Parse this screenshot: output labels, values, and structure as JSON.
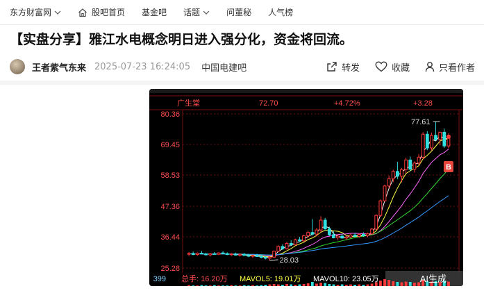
{
  "nav": {
    "site": "东方财富网",
    "home": "股吧首页",
    "fund": "基金吧",
    "topic": "话题",
    "dong": "问董秘",
    "popular": "人气榜"
  },
  "post": {
    "title": "【实盘分享】雅江水电概念明日进入强分化，资金将回流。",
    "author": "王者紫气东来",
    "time": "2025-07-23 16:24:05",
    "bar": "中国电建吧",
    "forward": "转发",
    "collect": "收藏",
    "only_author": "只看作者"
  },
  "chart_data": {
    "type": "candlestick",
    "stock_label": "广生堂",
    "header_price": "72.70",
    "header_change": "+4.72%",
    "header_amount": "+3.28",
    "y_ticks": [
      "80.36",
      "69.45",
      "58.53",
      "47.36",
      "36.44",
      "25.28"
    ],
    "ylim": [
      25.28,
      80.36
    ],
    "high_label": "77.61",
    "low_label": "28.03",
    "badge": "B",
    "volume_axis": "399",
    "vol_text": "总手: 16.20万",
    "mavol5_text": "MAVOL5: 19.01万",
    "mavol10_text": "MAVOL10: 23.05万",
    "ai_label": "AI生成",
    "colors": {
      "up": "#ff3b3b",
      "down": "#33e0e0",
      "ma5": "#ffffff",
      "ma10": "#ffff44",
      "ma20": "#ff66ff",
      "ma30": "#33dd33",
      "ma60": "#3399ff"
    },
    "candles": [
      [
        30.2,
        31.0,
        29.6,
        30.5
      ],
      [
        30.5,
        31.2,
        29.9,
        30.1
      ],
      [
        30.1,
        30.9,
        29.7,
        30.6
      ],
      [
        30.6,
        31.4,
        30.2,
        30.3
      ],
      [
        30.3,
        30.8,
        29.8,
        30.0
      ],
      [
        30.0,
        30.7,
        29.5,
        30.4
      ],
      [
        30.4,
        31.0,
        30.0,
        30.2
      ],
      [
        30.2,
        30.9,
        29.9,
        30.7
      ],
      [
        30.7,
        31.3,
        30.3,
        30.4
      ],
      [
        30.4,
        30.9,
        29.9,
        30.1
      ],
      [
        30.1,
        30.6,
        29.6,
        30.3
      ],
      [
        30.3,
        30.8,
        29.8,
        29.9
      ],
      [
        29.9,
        30.5,
        29.4,
        30.2
      ],
      [
        30.2,
        30.7,
        29.7,
        29.8
      ],
      [
        29.8,
        30.3,
        29.2,
        29.5
      ],
      [
        29.5,
        30.1,
        28.9,
        29.8
      ],
      [
        29.8,
        30.4,
        29.3,
        29.4
      ],
      [
        29.4,
        30.0,
        28.8,
        29.1
      ],
      [
        29.1,
        29.6,
        28.4,
        28.8
      ],
      [
        28.8,
        29.5,
        28.0,
        29.2
      ],
      [
        29.2,
        31.6,
        29.0,
        31.3
      ],
      [
        31.3,
        33.4,
        31.0,
        33.0
      ],
      [
        33.0,
        33.8,
        31.8,
        32.2
      ],
      [
        32.2,
        34.6,
        31.9,
        34.1
      ],
      [
        34.1,
        35.2,
        33.2,
        33.6
      ],
      [
        33.6,
        35.8,
        33.3,
        35.4
      ],
      [
        35.4,
        36.4,
        34.6,
        35.0
      ],
      [
        35.0,
        37.2,
        34.7,
        36.8
      ],
      [
        36.8,
        38.6,
        36.2,
        38.0
      ],
      [
        38.0,
        42.8,
        36.9,
        37.4
      ],
      [
        37.4,
        39.6,
        36.6,
        38.9
      ],
      [
        38.9,
        43.8,
        38.1,
        42.4
      ],
      [
        42.4,
        43.2,
        38.7,
        39.3
      ],
      [
        39.3,
        40.1,
        36.8,
        37.2
      ],
      [
        37.2,
        38.4,
        35.9,
        36.1
      ],
      [
        36.1,
        37.3,
        35.3,
        36.7
      ],
      [
        36.7,
        37.5,
        35.8,
        36.0
      ],
      [
        36.0,
        36.9,
        35.4,
        36.4
      ],
      [
        36.4,
        37.6,
        35.9,
        37.1
      ],
      [
        37.1,
        37.9,
        36.3,
        36.6
      ],
      [
        36.6,
        37.7,
        36.1,
        37.3
      ],
      [
        37.3,
        38.1,
        36.5,
        36.8
      ],
      [
        36.8,
        37.9,
        36.3,
        37.5
      ],
      [
        37.5,
        39.6,
        37.2,
        39.2
      ],
      [
        39.2,
        44.5,
        38.9,
        44.1
      ],
      [
        44.1,
        49.8,
        43.6,
        49.3
      ],
      [
        49.3,
        55.1,
        48.9,
        54.6
      ],
      [
        54.6,
        58.3,
        53.8,
        57.2
      ],
      [
        57.2,
        60.4,
        56.0,
        59.8
      ],
      [
        59.8,
        63.2,
        57.1,
        58.1
      ],
      [
        58.1,
        61.0,
        55.9,
        60.5
      ],
      [
        60.5,
        64.7,
        59.2,
        63.9
      ],
      [
        63.9,
        65.1,
        59.9,
        60.6
      ],
      [
        60.6,
        63.4,
        59.4,
        62.8
      ],
      [
        62.8,
        66.0,
        61.9,
        64.9
      ],
      [
        64.9,
        73.8,
        64.1,
        73.1
      ],
      [
        73.1,
        74.2,
        67.4,
        68.2
      ],
      [
        68.2,
        73.6,
        67.3,
        72.7
      ],
      [
        72.7,
        77.61,
        70.8,
        71.2
      ],
      [
        71.2,
        74.0,
        69.2,
        73.8
      ],
      [
        73.8,
        75.1,
        68.2,
        68.9
      ],
      [
        68.9,
        73.4,
        68.1,
        72.7
      ]
    ],
    "volumes": [
      3,
      2,
      2,
      3,
      2,
      2,
      3,
      2,
      2,
      2,
      3,
      2,
      2,
      3,
      2,
      3,
      2,
      3,
      4,
      5,
      6,
      5,
      4,
      6,
      5,
      4,
      5,
      6,
      8,
      12,
      7,
      10,
      9,
      6,
      5,
      4,
      5,
      4,
      5,
      4,
      5,
      4,
      5,
      7,
      11,
      16,
      20,
      18,
      14,
      12,
      11,
      13,
      12,
      10,
      11,
      17,
      14,
      13,
      15,
      12,
      16,
      13
    ]
  }
}
